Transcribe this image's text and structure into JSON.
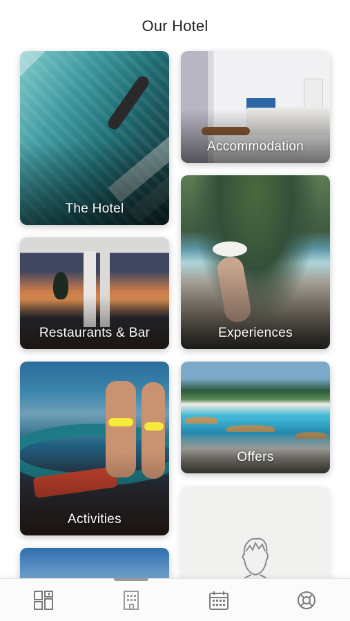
{
  "header": {
    "title": "Our Hotel"
  },
  "cards": {
    "hotel": {
      "label": "The Hotel"
    },
    "accommodation": {
      "label": "Accommodation"
    },
    "restaurants": {
      "label": "Restaurants & Bar"
    },
    "experiences": {
      "label": "Experiences"
    },
    "activities": {
      "label": "Activities"
    },
    "offers": {
      "label": "Offers"
    }
  },
  "tabbar": {
    "tabs": [
      {
        "icon": "dashboard-icon",
        "active": false
      },
      {
        "icon": "building-icon",
        "active": true
      },
      {
        "icon": "calendar-icon",
        "active": false
      },
      {
        "icon": "lifebuoy-icon",
        "active": false
      }
    ]
  },
  "colors": {
    "accent": "#9a9a9a",
    "icon": "#7a7a7a",
    "background": "#ffffff"
  }
}
